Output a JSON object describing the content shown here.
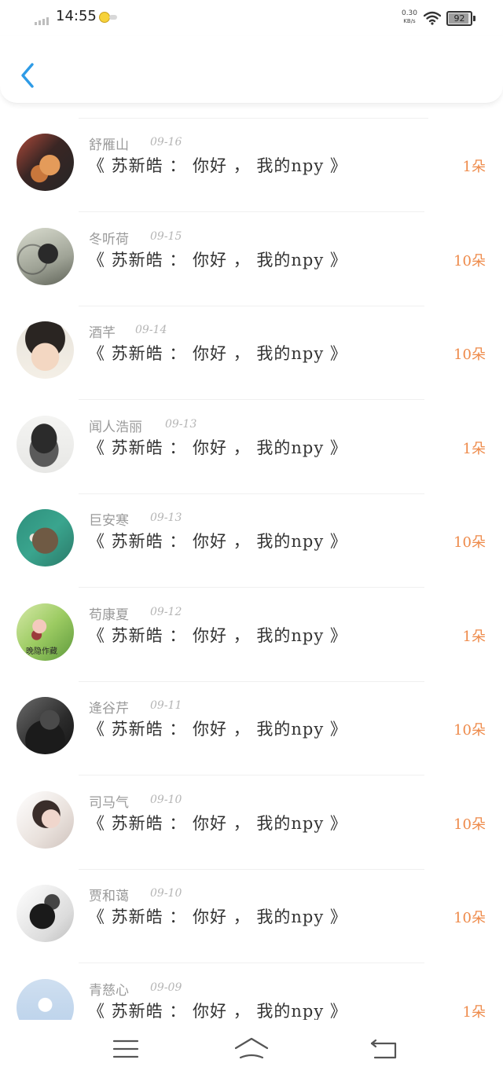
{
  "status_bar": {
    "time": "14:55",
    "net_speed_value": "0.30",
    "net_speed_unit": "KB/s",
    "battery_level": "92"
  },
  "items": [
    {
      "name": "舒雁山",
      "date": "09-16",
      "book": "《 苏新皓 ： 你好 ， 我的npy 》",
      "count": "1朵"
    },
    {
      "name": "冬听荷",
      "date": "09-15",
      "book": "《 苏新皓 ： 你好 ， 我的npy 》",
      "count": "10朵"
    },
    {
      "name": "酒芊",
      "date": "09-14",
      "book": "《 苏新皓 ： 你好 ， 我的npy 》",
      "count": "10朵"
    },
    {
      "name": "闻人浩丽",
      "date": "09-13",
      "book": "《 苏新皓 ： 你好 ， 我的npy 》",
      "count": "1朵"
    },
    {
      "name": "巨安寒",
      "date": "09-13",
      "book": "《 苏新皓 ： 你好 ， 我的npy 》",
      "count": "10朵"
    },
    {
      "name": "苟康夏",
      "date": "09-12",
      "book": "《 苏新皓 ： 你好 ， 我的npy 》",
      "count": "1朵"
    },
    {
      "name": "逄谷芹",
      "date": "09-11",
      "book": "《 苏新皓 ： 你好 ， 我的npy 》",
      "count": "10朵"
    },
    {
      "name": "司马气",
      "date": "09-10",
      "book": "《 苏新皓 ： 你好 ， 我的npy 》",
      "count": "10朵"
    },
    {
      "name": "贾和蔼",
      "date": "09-10",
      "book": "《 苏新皓 ： 你好 ， 我的npy 》",
      "count": "10朵"
    },
    {
      "name": "青慈心",
      "date": "09-09",
      "book": "《 苏新皓 ： 你好 ， 我的npy 》",
      "count": "1朵"
    }
  ],
  "avatar_watermark": "晚隐作藏",
  "colors": {
    "accent_blue": "#2e9be6",
    "count_orange": "#ee8a4a",
    "name_gray": "#9a9a9a",
    "title_dark": "#333333"
  }
}
